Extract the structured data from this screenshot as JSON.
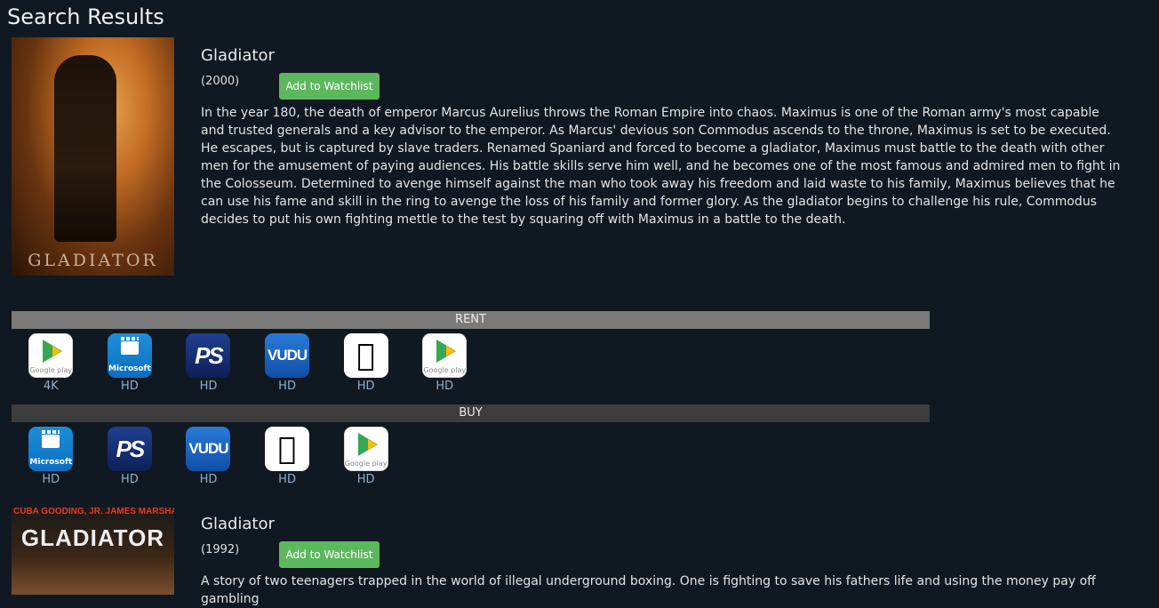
{
  "page": {
    "title": "Search Results"
  },
  "movies": [
    {
      "title": "Gladiator",
      "year": "(2000)",
      "watchlist_label": "Add to Watchlist",
      "poster_text": "GLADIATOR",
      "description": "In the year 180, the death of emperor Marcus Aurelius throws the Roman Empire into chaos. Maximus is one of the Roman army's most capable and trusted generals and a key advisor to the emperor. As Marcus' devious son Commodus ascends to the throne, Maximus is set to be executed. He escapes, but is captured by slave traders. Renamed Spaniard and forced to become a gladiator, Maximus must battle to the death with other men for the amusement of paying audiences. His battle skills serve him well, and he becomes one of the most famous and admired men to fight in the Colosseum. Determined to avenge himself against the man who took away his freedom and laid waste to his family, Maximus believes that he can use his fame and skill in the ring to avenge the loss of his family and former glory. As the gladiator begins to challenge his rule, Commodus decides to put his own fighting mettle to the test by squaring off with Maximus in a battle to the death.",
      "rent_label": "RENT",
      "rent": [
        {
          "icon": "google-play-icon",
          "icon_text": "Google play",
          "quality": "4K"
        },
        {
          "icon": "microsoft-icon",
          "icon_text": "Microsoft",
          "quality": "HD"
        },
        {
          "icon": "playstation-icon",
          "icon_text": "",
          "quality": "HD"
        },
        {
          "icon": "vudu-icon",
          "icon_text": "VUDU",
          "quality": "HD"
        },
        {
          "icon": "apple-icon",
          "icon_text": "",
          "quality": "HD"
        },
        {
          "icon": "google-play-icon",
          "icon_text": "Google play",
          "quality": "HD"
        }
      ],
      "buy_label": "BUY",
      "buy": [
        {
          "icon": "microsoft-icon",
          "icon_text": "Microsoft",
          "quality": "HD"
        },
        {
          "icon": "playstation-icon",
          "icon_text": "",
          "quality": "HD"
        },
        {
          "icon": "vudu-icon",
          "icon_text": "VUDU",
          "quality": "HD"
        },
        {
          "icon": "apple-icon",
          "icon_text": "",
          "quality": "HD"
        },
        {
          "icon": "google-play-icon",
          "icon_text": "Google play",
          "quality": "HD"
        }
      ]
    },
    {
      "title": "Gladiator",
      "year": "(1992)",
      "watchlist_label": "Add to Watchlist",
      "poster_actors": "CUBA GOODING, JR.  JAMES MARSHALL",
      "poster_text": "GLADIATOR",
      "description": "A story of two teenagers trapped in the world of illegal underground boxing. One is fighting to save his fathers life and using the money pay off gambling"
    }
  ],
  "colors": {
    "background": "#101821",
    "accent_button": "#5cb85c",
    "rent_bar": "#7a7a7a",
    "buy_bar": "#3d3d3d",
    "quality_text": "#8fb0cc"
  }
}
